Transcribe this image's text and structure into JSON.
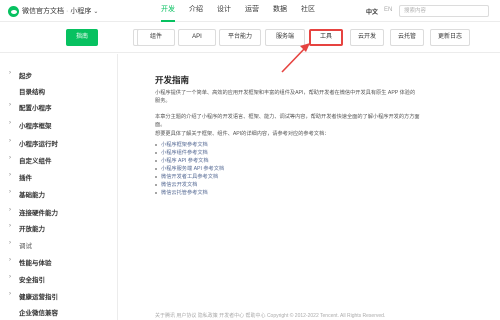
{
  "brand": {
    "title": "微信官方文档",
    "section": "小程序"
  },
  "nav": [
    "开发",
    "介绍",
    "设计",
    "运营",
    "数据",
    "社区"
  ],
  "lang": {
    "zh": "中文",
    "en": "EN"
  },
  "search": {
    "placeholder": "搜索内容"
  },
  "tabs": [
    "指南",
    "框架",
    "组件",
    "API",
    "平台能力",
    "服务端",
    "工具",
    "云开发",
    "云托管",
    "更新日志"
  ],
  "sidebar": [
    "起步",
    "目录结构",
    "配置小程序",
    "小程序框架",
    "小程序运行时",
    "自定义组件",
    "插件",
    "基础能力",
    "连接硬件能力",
    "开放能力",
    "调试",
    "性能与体验",
    "安全指引",
    "健康运营指引",
    "企业微信兼容"
  ],
  "content": {
    "title": "开发指南",
    "p1": "小程序提供了一个简单、高效的应用开发框架和丰富的组件及API，帮助开发者在微信中开发具有原生 APP 体验的服务。",
    "p2": "本章分主题的介绍了小程序的开发语言、框架、能力、调试等内容，帮助开发者快速全面的了解小程序开发的方方面面。",
    "p3": "想要更具体了解关于框架、组件、API的详细内容，请参考对应的参考文档：",
    "links": [
      "小程序框架参考文档",
      "小程序组件参考文档",
      "小程序 API 参考文档",
      "小程序服务端 API 参考文档",
      "微信开发者工具参考文档",
      "微信云开发文档",
      "微信云托管参考文档"
    ],
    "footer": "关于腾讯  用户协议  隐私政策  开发者中心  帮助中心  Copyright © 2012-2022 Tencent. All Rights Reserved."
  },
  "colors": {
    "accent": "#07c160",
    "highlight": "#e64340",
    "link": "#576b95"
  }
}
